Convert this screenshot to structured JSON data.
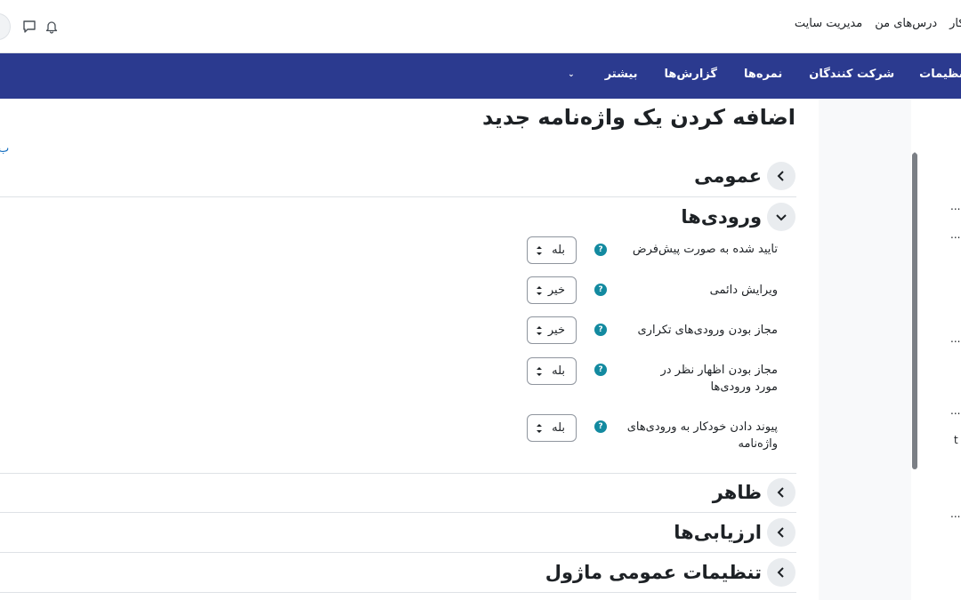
{
  "topnav": {
    "items": [
      "ر کار",
      "درس‌های من",
      "مدیریت سایت"
    ]
  },
  "secnav": {
    "items": [
      "تنظیمات",
      "شرکت کنندگان",
      "نمره‌ها",
      "گزارش‌ها",
      "بیشتر"
    ]
  },
  "page": {
    "title": "اضافه کردن یک واژه‌نامه جدید",
    "left_link": "ب"
  },
  "sections": {
    "general": "عمومی",
    "entries": "ورودی‌ها",
    "appearance": "ظاهر",
    "ratings": "ارزیابی‌ها",
    "module_settings": "تنظیمات عمومی ماژول"
  },
  "fields": [
    {
      "label": "تایید شده به صورت پیش‌فرض",
      "value": "بله"
    },
    {
      "label": "ویرایش دائمی",
      "value": "خیر"
    },
    {
      "label": "مجاز بودن ورودی‌های تکراری",
      "value": "خیر"
    },
    {
      "label": "مجاز بودن اظهار نظر در مورد ورودی‌ها",
      "value": "بله"
    },
    {
      "label": "پیوند دادن خودکار به ورودی‌های واژه‌نامه",
      "value": "بله"
    }
  ],
  "drawer": {
    "dots": [
      "...",
      "...",
      "...",
      "...",
      "...",
      "t",
      "..."
    ]
  },
  "colors": {
    "nav_blue": "#2b3a8f",
    "help_teal": "#138aa0",
    "link_blue": "#0f6cbf"
  }
}
